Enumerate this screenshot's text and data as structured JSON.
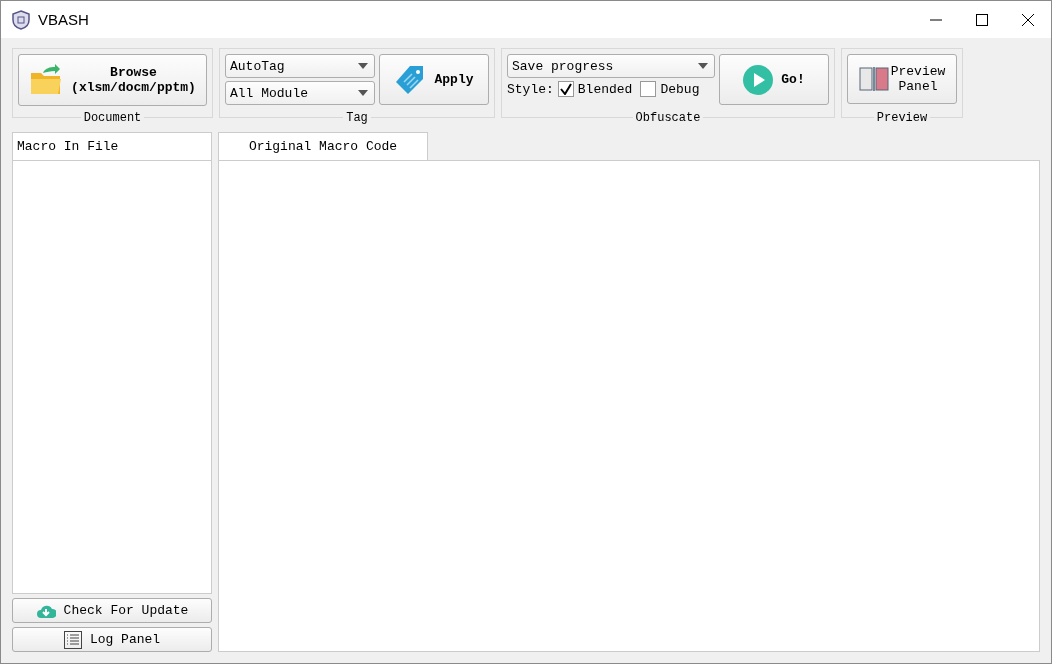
{
  "window": {
    "title": "VBASH"
  },
  "document": {
    "title": "Document",
    "browse_button": "Browse\n(xlsm/docm/pptm)"
  },
  "tag": {
    "title": "Tag",
    "dropdowns": [
      {
        "value": "AutoTag"
      },
      {
        "value": "All Module"
      }
    ],
    "apply_button": "Apply"
  },
  "obfuscate": {
    "title": "Obfuscate",
    "dropdown": {
      "value": "Save progress"
    },
    "style_label": "Style:",
    "options": [
      {
        "label": "Blended",
        "checked": true
      },
      {
        "label": "Debug",
        "checked": false
      }
    ],
    "go_button": "Go!"
  },
  "preview": {
    "title": "Preview",
    "button": "Preview\nPanel"
  },
  "macro_list": {
    "header": "Macro In File"
  },
  "tabs": [
    {
      "label": "Original Macro Code",
      "selected": true
    }
  ],
  "sidebar_buttons": [
    {
      "kind": "update",
      "label": "Check For Update"
    },
    {
      "kind": "log",
      "label": "Log Panel"
    }
  ]
}
